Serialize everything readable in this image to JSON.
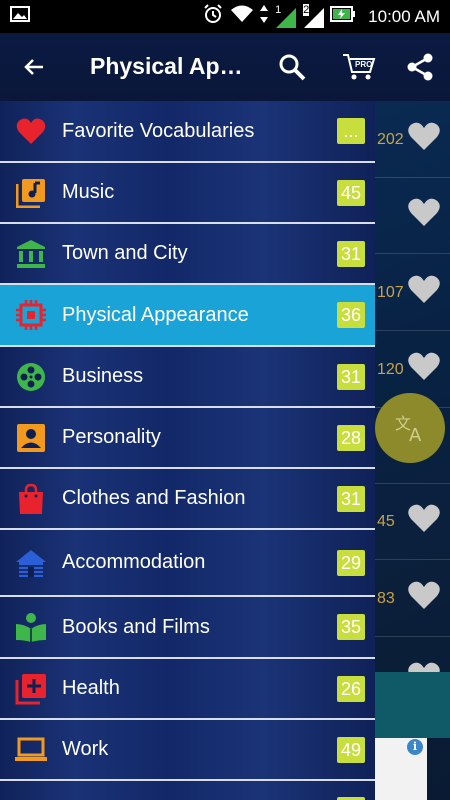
{
  "status_bar": {
    "time": "10:00 AM",
    "sim1": "1",
    "sim2": "2"
  },
  "toolbar": {
    "title": "Physical Ap…",
    "pro_label": "PRO"
  },
  "background_list": {
    "counts": [
      "202",
      "",
      "107",
      "120",
      "",
      "45",
      "83",
      ""
    ]
  },
  "fab": {
    "icon": "translate-icon"
  },
  "ad": {
    "info": "i"
  },
  "drawer": {
    "items": [
      {
        "label": "Favorite Vocabularies",
        "badge": "...",
        "icon": "heart-icon",
        "color": "#e8232e"
      },
      {
        "label": "Music",
        "badge": "45",
        "icon": "music-library-icon",
        "color": "#f29a1f"
      },
      {
        "label": "Town and City",
        "badge": "31",
        "icon": "bank-icon",
        "color": "#3fb64a"
      },
      {
        "label": "Physical Appearance",
        "badge": "36",
        "icon": "chip-icon",
        "color": "#e8232e"
      },
      {
        "label": "Business",
        "badge": "31",
        "icon": "film-reel-icon",
        "color": "#3fb64a"
      },
      {
        "label": "Personality",
        "badge": "28",
        "icon": "person-box-icon",
        "color": "#f29a1f"
      },
      {
        "label": "Clothes and Fashion",
        "badge": "31",
        "icon": "shopping-bag-icon",
        "color": "#e8232e"
      },
      {
        "label": "Accommodation",
        "badge": "29",
        "icon": "cabin-icon",
        "color": "#2a5fd8"
      },
      {
        "label": "Books and Films",
        "badge": "35",
        "icon": "reading-icon",
        "color": "#3fb64a"
      },
      {
        "label": "Health",
        "badge": "26",
        "icon": "medical-plus-icon",
        "color": "#e8232e"
      },
      {
        "label": "Work",
        "badge": "49",
        "icon": "laptop-icon",
        "color": "#f29a1f"
      }
    ]
  }
}
